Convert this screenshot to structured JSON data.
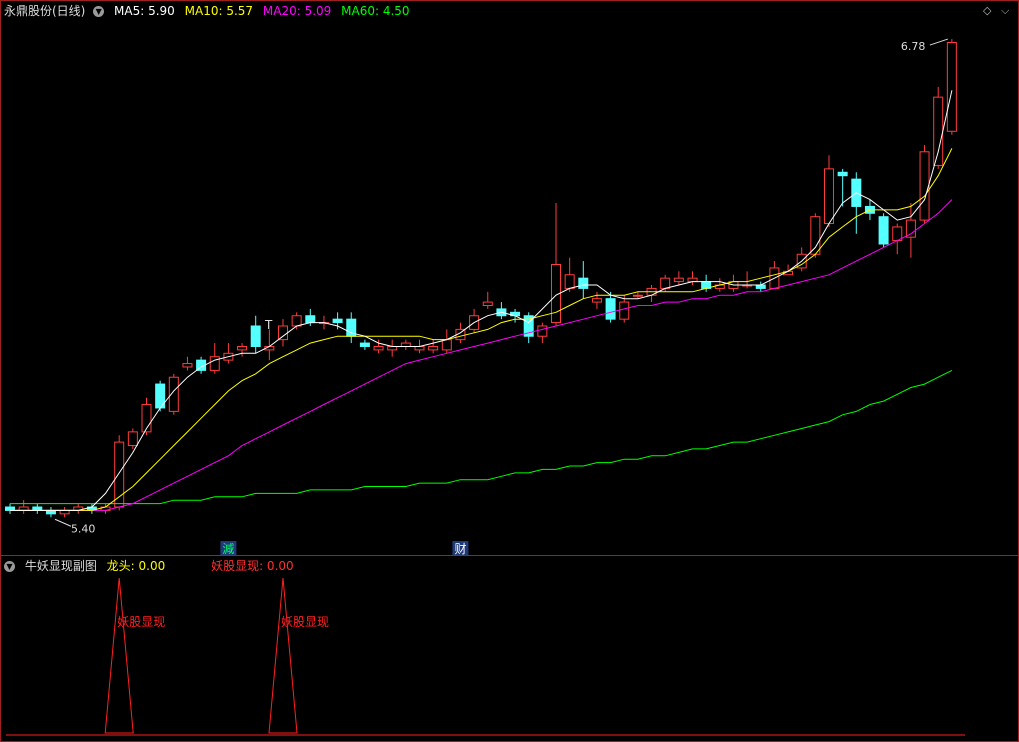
{
  "main_panel": {
    "title": "永鼎股份(日线)",
    "ma_labels": [
      {
        "text": "MA5: 5.90",
        "color": "#ffffff"
      },
      {
        "text": "MA10: 5.57",
        "color": "#ffff00"
      },
      {
        "text": "MA20: 5.09",
        "color": "#ff00ff"
      },
      {
        "text": "MA60: 4.50",
        "color": "#00ff00"
      }
    ],
    "corner_icons": [
      "diamond-icon",
      "expand-icon"
    ]
  },
  "sub_panel": {
    "title": "牛妖显现副图",
    "label_longtou": "龙头: 0.00",
    "label_yaogu": "妖股显现: 0.00",
    "signal_text": "妖股显现"
  },
  "colors": {
    "up": "#ff3c3c",
    "down": "#54ffff",
    "ma5": "#ffffff",
    "ma10": "#ffff00",
    "ma20": "#ff00ff",
    "ma60": "#00ff00",
    "border": "#a02020"
  },
  "chart_data": {
    "type": "candlestick",
    "ylim": [
      5.3,
      6.84
    ],
    "price_markers": {
      "high": "6.78",
      "low": "5.40"
    },
    "annotations": [
      {
        "index": 20,
        "text": "T"
      }
    ],
    "bottom_tags": [
      {
        "index": 16,
        "text": "減",
        "color": "#00ff66"
      },
      {
        "index": 33,
        "text": "财",
        "color": "#ffffff"
      }
    ],
    "candles": [
      [
        5.42,
        5.41,
        5.43,
        5.4
      ],
      [
        5.41,
        5.42,
        5.44,
        5.4
      ],
      [
        5.42,
        5.41,
        5.43,
        5.4
      ],
      [
        5.41,
        5.4,
        5.42,
        5.39
      ],
      [
        5.4,
        5.41,
        5.42,
        5.39
      ],
      [
        5.41,
        5.42,
        5.43,
        5.4
      ],
      [
        5.42,
        5.41,
        5.43,
        5.4
      ],
      [
        5.41,
        5.42,
        5.43,
        5.4
      ],
      [
        5.42,
        5.61,
        5.63,
        5.41
      ],
      [
        5.6,
        5.64,
        5.65,
        5.59
      ],
      [
        5.64,
        5.72,
        5.74,
        5.63
      ],
      [
        5.78,
        5.71,
        5.79,
        5.7
      ],
      [
        5.7,
        5.8,
        5.81,
        5.69
      ],
      [
        5.83,
        5.84,
        5.86,
        5.82
      ],
      [
        5.85,
        5.82,
        5.86,
        5.81
      ],
      [
        5.82,
        5.86,
        5.9,
        5.81
      ],
      [
        5.85,
        5.87,
        5.9,
        5.84
      ],
      [
        5.88,
        5.89,
        5.9,
        5.86
      ],
      [
        5.95,
        5.89,
        5.98,
        5.87
      ],
      [
        5.88,
        5.89,
        5.94,
        5.85
      ],
      [
        5.91,
        5.95,
        5.97,
        5.89
      ],
      [
        5.95,
        5.98,
        5.99,
        5.94
      ],
      [
        5.98,
        5.96,
        6.0,
        5.95
      ],
      [
        5.96,
        5.96,
        5.98,
        5.94
      ],
      [
        5.97,
        5.96,
        5.99,
        5.94
      ],
      [
        5.97,
        5.92,
        5.99,
        5.9
      ],
      [
        5.9,
        5.89,
        5.91,
        5.88
      ],
      [
        5.88,
        5.89,
        5.91,
        5.87
      ],
      [
        5.88,
        5.89,
        5.91,
        5.86
      ],
      [
        5.89,
        5.9,
        5.91,
        5.88
      ],
      [
        5.88,
        5.89,
        5.91,
        5.87
      ],
      [
        5.88,
        5.89,
        5.91,
        5.87
      ],
      [
        5.88,
        5.91,
        5.94,
        5.87
      ],
      [
        5.91,
        5.94,
        5.96,
        5.9
      ],
      [
        5.94,
        5.98,
        6.0,
        5.93
      ],
      [
        6.01,
        6.02,
        6.05,
        6.0
      ],
      [
        6.0,
        5.98,
        6.02,
        5.97
      ],
      [
        5.99,
        5.98,
        6.0,
        5.96
      ],
      [
        5.98,
        5.92,
        5.99,
        5.9
      ],
      [
        5.92,
        5.95,
        5.96,
        5.9
      ],
      [
        5.96,
        6.13,
        6.31,
        5.95
      ],
      [
        6.06,
        6.1,
        6.15,
        6.05
      ],
      [
        6.09,
        6.06,
        6.14,
        6.03
      ],
      [
        6.02,
        6.03,
        6.05,
        6.0
      ],
      [
        6.03,
        5.97,
        6.05,
        5.96
      ],
      [
        5.97,
        6.02,
        6.04,
        5.96
      ],
      [
        6.04,
        6.04,
        6.05,
        6.03
      ],
      [
        6.04,
        6.06,
        6.07,
        6.02
      ],
      [
        6.06,
        6.09,
        6.1,
        6.05
      ],
      [
        6.08,
        6.09,
        6.11,
        6.07
      ],
      [
        6.08,
        6.09,
        6.11,
        6.07
      ],
      [
        6.08,
        6.06,
        6.1,
        6.05
      ],
      [
        6.06,
        6.07,
        6.09,
        6.05
      ],
      [
        6.06,
        6.08,
        6.1,
        6.05
      ],
      [
        6.07,
        6.07,
        6.11,
        6.06
      ],
      [
        6.07,
        6.06,
        6.08,
        6.05
      ],
      [
        6.06,
        6.12,
        6.14,
        6.06
      ],
      [
        6.1,
        6.11,
        6.13,
        6.1
      ],
      [
        6.12,
        6.16,
        6.18,
        6.11
      ],
      [
        6.16,
        6.27,
        6.28,
        6.15
      ],
      [
        6.25,
        6.41,
        6.45,
        6.24
      ],
      [
        6.4,
        6.39,
        6.41,
        6.3
      ],
      [
        6.38,
        6.3,
        6.4,
        6.22
      ],
      [
        6.3,
        6.28,
        6.32,
        6.26
      ],
      [
        6.27,
        6.19,
        6.28,
        6.18
      ],
      [
        6.2,
        6.24,
        6.25,
        6.16
      ],
      [
        6.21,
        6.26,
        6.31,
        6.15
      ],
      [
        6.26,
        6.46,
        6.48,
        6.25
      ],
      [
        6.42,
        6.62,
        6.65,
        6.41
      ],
      [
        6.52,
        6.78,
        6.79,
        6.51
      ]
    ],
    "ma5": [
      5.41,
      5.41,
      5.41,
      5.41,
      5.41,
      5.41,
      5.42,
      5.46,
      5.52,
      5.58,
      5.65,
      5.71,
      5.76,
      5.8,
      5.83,
      5.85,
      5.86,
      5.87,
      5.87,
      5.89,
      5.92,
      5.95,
      5.96,
      5.96,
      5.95,
      5.93,
      5.92,
      5.9,
      5.89,
      5.89,
      5.89,
      5.9,
      5.91,
      5.93,
      5.96,
      5.98,
      5.99,
      5.98,
      5.96,
      6.0,
      6.04,
      6.06,
      6.07,
      6.07,
      6.04,
      6.03,
      6.03,
      6.04,
      6.06,
      6.07,
      6.08,
      6.08,
      6.08,
      6.07,
      6.07,
      6.07,
      6.09,
      6.11,
      6.14,
      6.18,
      6.25,
      6.31,
      6.34,
      6.32,
      6.29,
      6.26,
      6.27,
      6.32,
      6.46,
      6.64
    ],
    "ma10": [
      5.41,
      5.41,
      5.41,
      5.41,
      5.41,
      5.41,
      5.41,
      5.42,
      5.45,
      5.48,
      5.52,
      5.56,
      5.6,
      5.64,
      5.68,
      5.72,
      5.76,
      5.79,
      5.81,
      5.84,
      5.86,
      5.88,
      5.9,
      5.91,
      5.92,
      5.92,
      5.92,
      5.92,
      5.92,
      5.92,
      5.92,
      5.91,
      5.91,
      5.92,
      5.93,
      5.94,
      5.96,
      5.97,
      5.97,
      5.98,
      5.99,
      6.01,
      6.03,
      6.04,
      6.04,
      6.04,
      6.05,
      6.05,
      6.05,
      6.05,
      6.05,
      6.06,
      6.07,
      6.08,
      6.08,
      6.09,
      6.1,
      6.11,
      6.13,
      6.16,
      6.21,
      6.24,
      6.27,
      6.29,
      6.29,
      6.29,
      6.3,
      6.33,
      6.39,
      6.47
    ],
    "ma20": [
      5.41,
      5.41,
      5.41,
      5.41,
      5.41,
      5.41,
      5.41,
      5.41,
      5.42,
      5.43,
      5.45,
      5.47,
      5.49,
      5.51,
      5.53,
      5.55,
      5.57,
      5.6,
      5.62,
      5.64,
      5.66,
      5.68,
      5.7,
      5.72,
      5.74,
      5.76,
      5.78,
      5.8,
      5.82,
      5.84,
      5.85,
      5.86,
      5.87,
      5.88,
      5.89,
      5.9,
      5.91,
      5.92,
      5.93,
      5.94,
      5.95,
      5.96,
      5.97,
      5.98,
      5.99,
      6.0,
      6.01,
      6.01,
      6.02,
      6.02,
      6.03,
      6.03,
      6.04,
      6.04,
      6.05,
      6.05,
      6.06,
      6.07,
      6.08,
      6.09,
      6.1,
      6.12,
      6.14,
      6.16,
      6.18,
      6.2,
      6.22,
      6.25,
      6.28,
      6.32
    ],
    "ma60": [
      5.43,
      5.43,
      5.43,
      5.43,
      5.43,
      5.43,
      5.43,
      5.43,
      5.43,
      5.43,
      5.43,
      5.43,
      5.44,
      5.44,
      5.44,
      5.45,
      5.45,
      5.45,
      5.46,
      5.46,
      5.46,
      5.46,
      5.47,
      5.47,
      5.47,
      5.47,
      5.48,
      5.48,
      5.48,
      5.48,
      5.49,
      5.49,
      5.49,
      5.5,
      5.5,
      5.5,
      5.51,
      5.52,
      5.52,
      5.53,
      5.53,
      5.54,
      5.54,
      5.55,
      5.55,
      5.56,
      5.56,
      5.57,
      5.57,
      5.58,
      5.59,
      5.59,
      5.6,
      5.61,
      5.61,
      5.62,
      5.63,
      5.64,
      5.65,
      5.66,
      5.67,
      5.69,
      5.7,
      5.72,
      5.73,
      5.75,
      5.77,
      5.78,
      5.8,
      5.82
    ],
    "signal": [
      0,
      0,
      0,
      0,
      0,
      0,
      0,
      0,
      1,
      0,
      0,
      0,
      0,
      0,
      0,
      0,
      0,
      0,
      0,
      0,
      1,
      0,
      0,
      0,
      0,
      0,
      0,
      0,
      0,
      0,
      0,
      0,
      0,
      0,
      0,
      0,
      0,
      0,
      0,
      0,
      0,
      0,
      0,
      0,
      0,
      0,
      0,
      0,
      0,
      0,
      0,
      0,
      0,
      0,
      0,
      0,
      0,
      0,
      0,
      0,
      0,
      0,
      0,
      0,
      0,
      0,
      0,
      0,
      0,
      0
    ]
  }
}
